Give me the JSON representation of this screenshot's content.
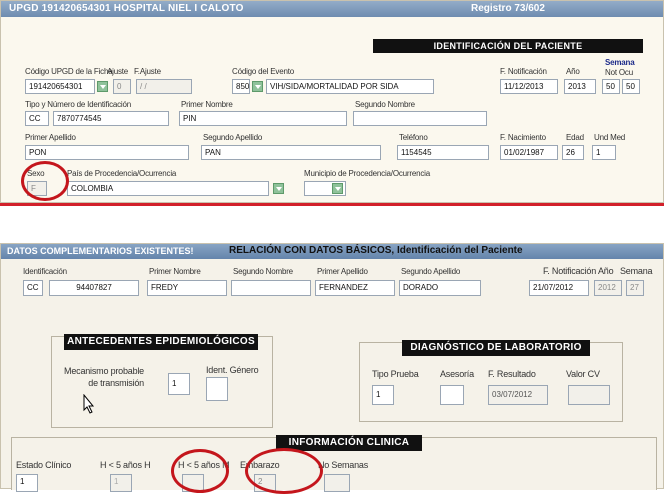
{
  "top": {
    "title": "UPGD 191420654301 HOSPITAL NIEL I CALOTO",
    "registro": "Registro 73/602",
    "section_header": "IDENTIFICACIÓN DEL PACIENTE",
    "labels": {
      "codigo_upgd": "Código UPGD de la Ficha",
      "ajuste": "Ajuste",
      "f_ajuste": "F.Ajuste",
      "codigo_evento": "Código del Evento",
      "f_notificacion": "F. Notificación",
      "anio": "Año",
      "semana": "Semana",
      "not_ocu": "Not Ocu",
      "tipo_num_id": "Tipo y Número de Identificación",
      "primer_nombre": "Primer Nombre",
      "segundo_nombre": "Segundo Nombre",
      "primer_apellido": "Primer Apellido",
      "segundo_apellido": "Segundo Apellido",
      "telefono": "Teléfono",
      "f_nacimiento": "F. Nacimiento",
      "edad": "Edad",
      "und_med": "Und Med",
      "sexo": "Sexo",
      "pais": "País de Procedencia/Ocurrencia",
      "municipio": "Municipio de Procedencia/Ocurrencia"
    },
    "values": {
      "codigo_upgd": "191420654301",
      "ajuste": "0",
      "f_ajuste": "/ /",
      "evento_codigo": "850",
      "evento_nombre": "VIH/SIDA/MORTALIDAD POR SIDA",
      "f_notificacion": "11/12/2013",
      "anio": "2013",
      "semana_not": "50",
      "semana_ocu": "50",
      "tipo_id": "CC",
      "num_id": "7870774545",
      "primer_nombre": "PIN",
      "segundo_nombre": "",
      "primer_apellido": "PON",
      "segundo_apellido": "PAN",
      "telefono": "1154545",
      "f_nacimiento": "01/02/1987",
      "edad": "26",
      "und_med": "1",
      "sexo": "F",
      "pais": "COLOMBIA",
      "municipio": ""
    }
  },
  "bottom": {
    "header_left": "DATOS COMPLEMENTARIOS EXISTENTES!",
    "header_right": "RELACIÓN CON DATOS BÁSICOS, Identificación del Paciente",
    "labels": {
      "identificacion": "Identificación",
      "primer_nombre": "Primer Nombre",
      "segundo_nombre": "Segundo Nombre",
      "primer_apellido": "Primer Apellido",
      "segundo_apellido": "Segundo Apellido",
      "f_notificacion": "F. Notificación",
      "anio": "Año",
      "semana": "Semana"
    },
    "values": {
      "tipo_id": "CC",
      "num_id": "94407827",
      "primer_nombre": "FREDY",
      "segundo_nombre": "",
      "primer_apellido": "FERNANDEZ",
      "segundo_apellido": "DORADO",
      "f_notificacion": "21/07/2012",
      "anio": "2012",
      "semana": "27"
    },
    "antecedentes": {
      "header": "ANTECEDENTES EPIDEMIOLÓGICOS",
      "mecanismo_label": "Mecanismo probable de transmisión",
      "mecanismo_value": "1",
      "ident_genero_label": "Ident. Género",
      "ident_genero_value": ""
    },
    "laboratorio": {
      "header": "DIAGNÓSTICO DE LABORATORIO",
      "tipo_prueba_label": "Tipo Prueba",
      "tipo_prueba_value": "1",
      "asesoria_label": "Asesoría",
      "asesoria_value": "",
      "f_resultado_label": "F. Resultado",
      "f_resultado_value": "03/07/2012",
      "valor_cv_label": "Valor CV",
      "valor_cv_value": ""
    },
    "clinica": {
      "header": "INFORMACIÓN CLINICA",
      "estado_clinico_label": "Estado Clínico",
      "estado_clinico_value": "1",
      "h5h_label": "H < 5 años H",
      "h5h_value": "1",
      "h5m_label": "H < 5 años M",
      "h5m_value": "",
      "embarazo_label": "Embarazo",
      "embarazo_value": "2",
      "no_semanas_label": "No Semanas",
      "no_semanas_value": ""
    }
  },
  "colors": {
    "title_bar": "#7f9aba",
    "separator": "#d2202a",
    "highlight": "#c4161c",
    "panel_top": "#fbf8ee",
    "panel_bottom": "#f5f2e9",
    "bottom_header": "#6f8fb4"
  }
}
